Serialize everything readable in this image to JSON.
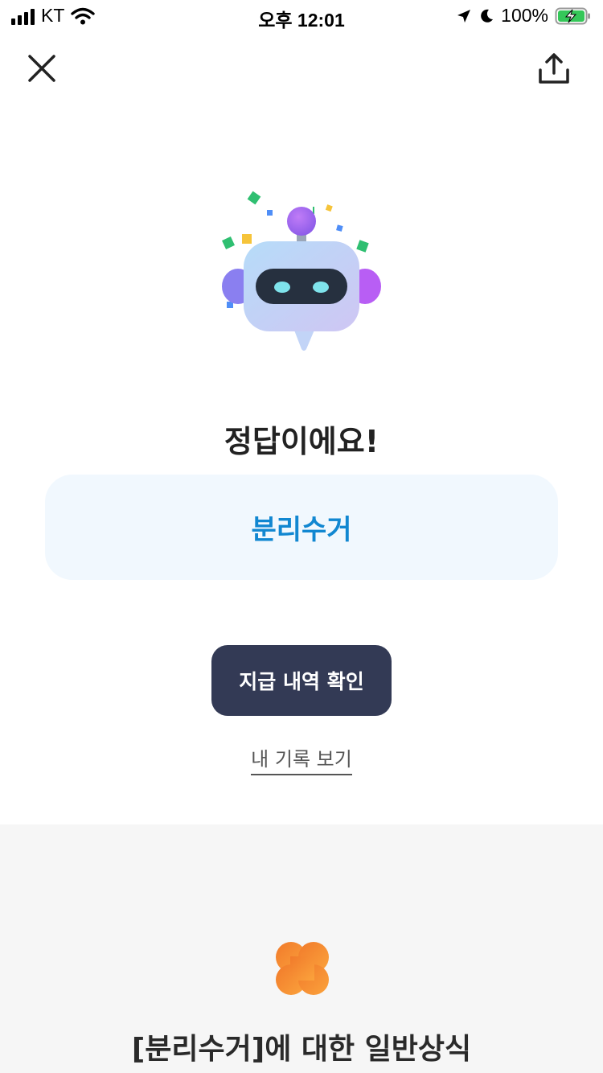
{
  "status_bar": {
    "carrier": "KT",
    "time": "오후 12:01",
    "battery": "100%",
    "icons": [
      "signal-icon",
      "wifi-icon",
      "location-arrow-icon",
      "moon-icon",
      "battery-charging-icon"
    ]
  },
  "header": {
    "close_icon": "close-icon",
    "share_icon": "share-icon"
  },
  "result": {
    "mascot": "robot-mascot-confetti",
    "title": "정답이에요!",
    "answer": "분리수거",
    "primary_button": "지급 내역 확인",
    "secondary_link": "내 기록 보기"
  },
  "info_section": {
    "icon": "clover-icon",
    "title": "[분리수거]에 대한 일반상식"
  },
  "colors": {
    "answer_text": "#1187d1",
    "answer_bg": "#f1f8fe",
    "button_bg": "#333a55",
    "clover": "#f7882f",
    "section_bg": "#f6f6f6"
  }
}
